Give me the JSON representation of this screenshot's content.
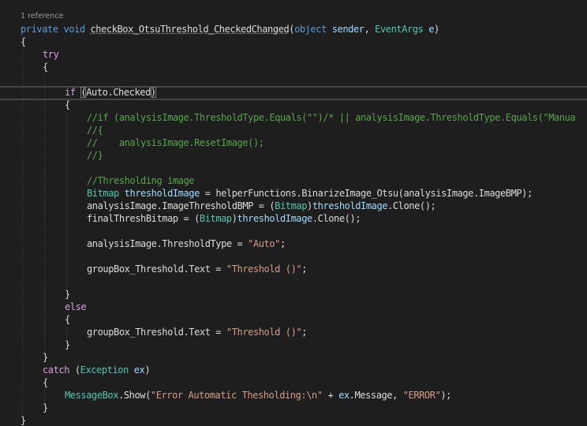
{
  "codelens": "1 reference",
  "code": {
    "l1": {
      "kw1": "private",
      "kw2": "void",
      "method": "checkBox_OtsuThreshold_CheckedChanged",
      "p1": "(",
      "t1": "object",
      "a1": "sender",
      "p2": ",",
      "t2": "EventArgs",
      "a2": "e",
      "p3": ")"
    },
    "l2": "{",
    "l3": "try",
    "l4": "{",
    "l5": {
      "kw": "if",
      "paren_open": "(",
      "expr": "Auto.Checked",
      "paren_close": ")"
    },
    "l6": "{",
    "l7": "//if (analysisImage.ThresholdType.Equals(\"\")/* || analysisImage.ThresholdType.Equals(\"Manua",
    "l8": "//{",
    "l9": "//    analysisImage.ResetImage();",
    "l10": "//}",
    "l11": "//Thresholding image",
    "l12": {
      "type": "Bitmap",
      "var": "thresholdImage",
      "rest": " = helperFunctions.BinarizeImage_Otsu(analysisImage.ImageBMP);"
    },
    "l13": {
      "lhs": "analysisImage.ImageThresholdBMP = (",
      "cast": "Bitmap",
      "mid": ")",
      "var": "thresholdImage",
      "rest": ".Clone();"
    },
    "l14": {
      "lhs": "finalThreshBitmap = (",
      "cast": "Bitmap",
      "mid": ")",
      "var": "thresholdImage",
      "rest": ".Clone();"
    },
    "l15": {
      "lhs": "analysisImage.ThresholdType = ",
      "str": "\"Auto\"",
      "end": ";"
    },
    "l16": {
      "lhs": "groupBox_Threshold.Text = ",
      "str": "\"Threshold ()\"",
      "end": ";"
    },
    "l17": "}",
    "l18": "else",
    "l19": "{",
    "l20": {
      "lhs": "groupBox_Threshold.Text = ",
      "str": "\"Threshold ()\"",
      "end": ";"
    },
    "l21": "}",
    "l22": "}",
    "l23": {
      "kw": "catch",
      "p1": " (",
      "type": "Exception",
      "var": "ex",
      "p2": ")"
    },
    "l24": "{",
    "l25": {
      "type": "MessageBox",
      "dot": ".",
      "method": "Show",
      "p1": "(",
      "str1": "\"Error Automatic Thesholding:\\n\"",
      "plus": " + ",
      "var": "ex",
      "member": ".Message, ",
      "str2": "\"ERROR\"",
      "end": ");"
    },
    "l26": "}",
    "l27": "}"
  },
  "colors": {
    "background": "#1e1e1e",
    "keyword": "#569cd6",
    "control_keyword": "#d8a0df",
    "type": "#4ec9b0",
    "identifier": "#9cdcfe",
    "string": "#d69d85",
    "comment": "#57a64a",
    "text": "#dcdcdc"
  }
}
